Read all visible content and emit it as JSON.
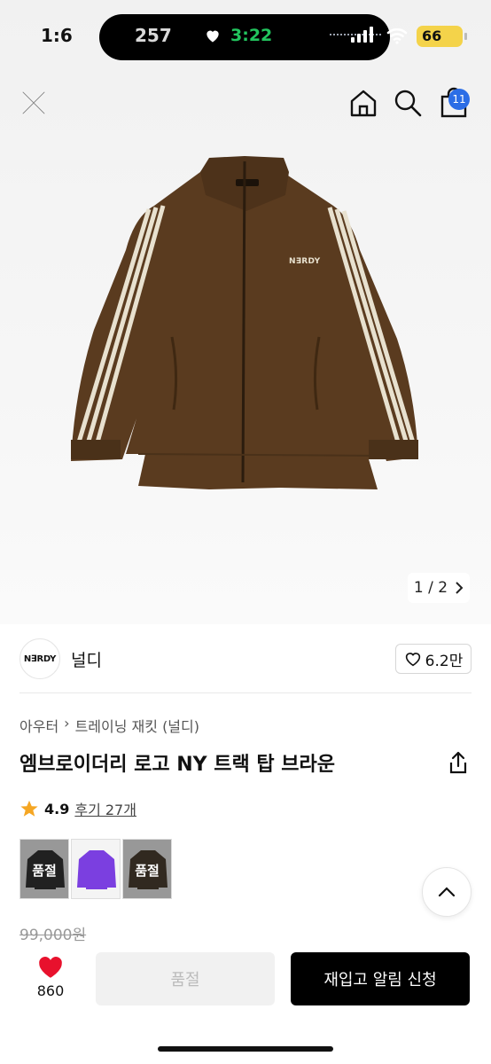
{
  "status_bar": {
    "time": "1:6",
    "island_time": "257",
    "call_time": "3:22",
    "battery": "66"
  },
  "nav": {
    "cart_count": "11"
  },
  "gallery": {
    "counter": "1 / 2",
    "logo_text": "N∃RDY"
  },
  "brand": {
    "logo": "N∃RDY",
    "name": "널디",
    "likes": "6.2만"
  },
  "product": {
    "breadcrumb": [
      "아우터",
      "트레이닝 재킷 (널디)"
    ],
    "title": "엠브로이더리 로고 NY 트랙 탑 브라운",
    "rating": "4.9",
    "reviews": "후기 27개",
    "price": "99,000원"
  },
  "swatches": [
    {
      "label": "품절",
      "color": "#1c1c1c"
    },
    {
      "label": "",
      "color": "#7b3fe0"
    },
    {
      "label": "품절",
      "color": "#3a2a1a"
    }
  ],
  "actions": {
    "fav_count": "860",
    "soldout": "품절",
    "restock": "재입고 알림 신청"
  },
  "colors": {
    "jacket": "#5a3b1f",
    "stripe": "#e8e1cf",
    "accent_badge": "#2b6de6",
    "heart": "#e8112d"
  }
}
